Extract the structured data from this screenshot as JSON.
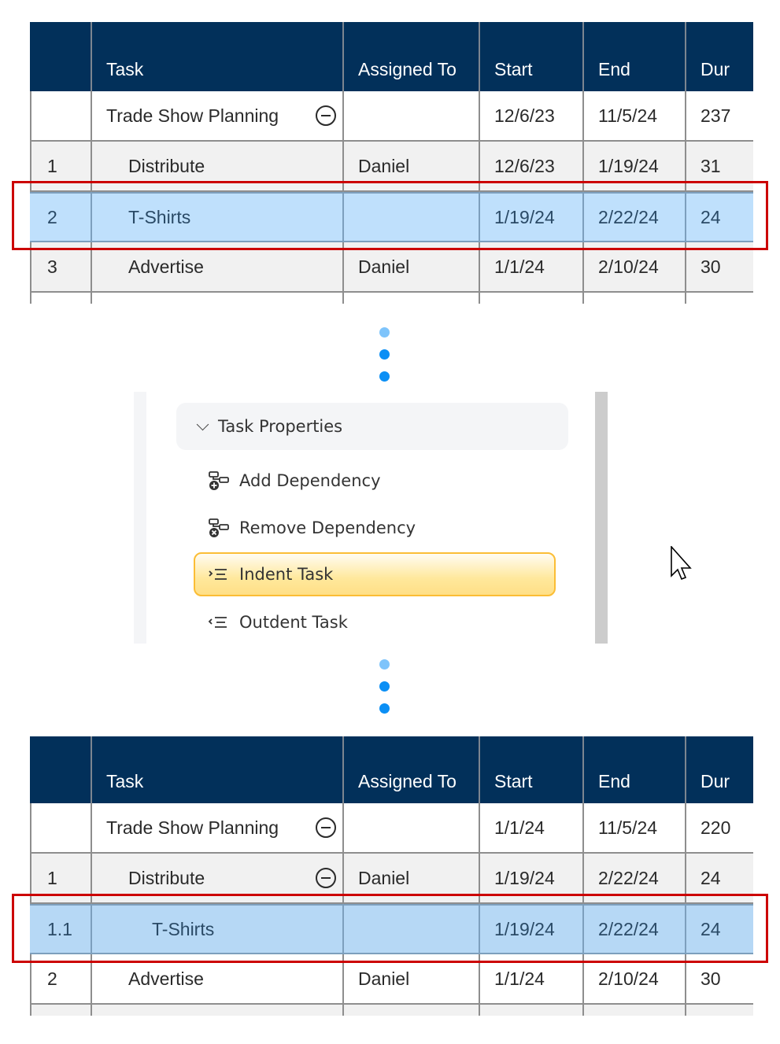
{
  "before_table": {
    "headers": [
      "",
      "Task",
      "Assigned To",
      "Start",
      "End",
      "Dur"
    ],
    "rows": [
      {
        "id": "",
        "task": "Trade Show Planning",
        "assigned": "",
        "start": "12/6/23",
        "end": "11/5/24",
        "dur": "237",
        "collapsible": true
      },
      {
        "id": "1",
        "task": "Distribute",
        "assigned": "Daniel",
        "start": "12/6/23",
        "end": "1/19/24",
        "dur": "31"
      },
      {
        "id": "2",
        "task": "T-Shirts",
        "assigned": "",
        "start": "1/19/24",
        "end": "2/22/24",
        "dur": "24",
        "selected": true
      },
      {
        "id": "3",
        "task": "Advertise",
        "assigned": "Daniel",
        "start": "1/1/24",
        "end": "2/10/24",
        "dur": "30"
      }
    ]
  },
  "menu": {
    "section_title": "Task Properties",
    "section_icon": "chevron-down-icon",
    "items": [
      {
        "label": "Add Dependency",
        "icon": "add-dependency-icon"
      },
      {
        "label": "Remove Dependency",
        "icon": "remove-dependency-icon"
      },
      {
        "label": "Indent Task",
        "icon": "indent-icon",
        "active": true
      },
      {
        "label": "Outdent Task",
        "icon": "outdent-icon"
      }
    ]
  },
  "after_table": {
    "headers": [
      "",
      "Task",
      "Assigned To",
      "Start",
      "End",
      "Dur"
    ],
    "rows": [
      {
        "id": "",
        "task": "Trade Show Planning",
        "assigned": "",
        "start": "1/1/24",
        "end": "11/5/24",
        "dur": "220",
        "collapsible": true
      },
      {
        "id": "1",
        "task": "Distribute",
        "assigned": "Daniel",
        "start": "1/19/24",
        "end": "2/22/24",
        "dur": "24",
        "collapsible": true
      },
      {
        "id": "1.1",
        "task": "T-Shirts",
        "assigned": "",
        "start": "1/19/24",
        "end": "2/22/24",
        "dur": "24",
        "selected": true
      },
      {
        "id": "2",
        "task": "Advertise",
        "assigned": "Daniel",
        "start": "1/1/24",
        "end": "2/10/24",
        "dur": "30"
      }
    ]
  },
  "colors": {
    "header_bg": "#02305a",
    "selection_bg": "#bfe0fc",
    "highlight_outline": "#cc0000",
    "active_menu_border": "#fbbd35",
    "dot_blue": "#0b8ff5"
  }
}
